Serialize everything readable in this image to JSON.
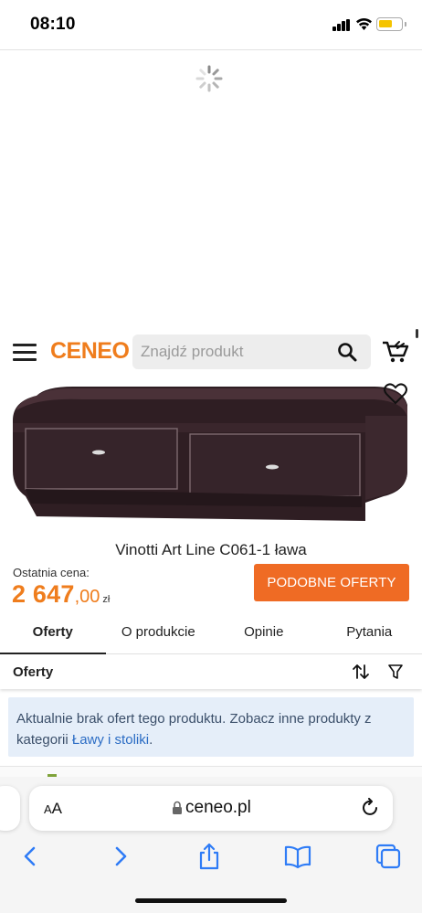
{
  "status_bar": {
    "time": "08:10",
    "icons": [
      "cellular-signal-icon",
      "wifi-icon",
      "battery-icon"
    ],
    "battery_color": "#f5c400"
  },
  "loading": {
    "icon": "loading-spinner-icon"
  },
  "header": {
    "logo": "CENEO",
    "search_placeholder": "Znajdź produkt",
    "icons": [
      "hamburger-menu-icon",
      "search-icon",
      "cart-icon"
    ],
    "brand_color": "#ef7d1d"
  },
  "product": {
    "title": "Vinotti Art Line C061-1 ława",
    "price_label": "Ostatnia cena:",
    "price_main": "2 647",
    "price_decimals": ",00",
    "currency": "zł",
    "similar_offers_button": "PODOBNE OFERTY",
    "button_color": "#ef6b24",
    "favorite_icon": "heart-icon"
  },
  "tabs": [
    {
      "label": "Oferty",
      "active": true
    },
    {
      "label": "O produkcie",
      "active": false
    },
    {
      "label": "Opinie",
      "active": false
    },
    {
      "label": "Pytania",
      "active": false
    }
  ],
  "offers": {
    "title": "Oferty",
    "icons": [
      "sort-icon",
      "filter-icon"
    ],
    "info_text": "Aktualnie brak ofert tego produktu. Zobacz inne produkty z kategorii",
    "info_link": "Ławy i stoliki",
    "info_suffix": "."
  },
  "browser": {
    "aa_label_small": "A",
    "aa_label_large": "A",
    "url": "ceneo.pl",
    "toolbar_icons": [
      "back-icon",
      "forward-icon",
      "share-icon",
      "bookmarks-icon",
      "tabs-icon"
    ]
  }
}
